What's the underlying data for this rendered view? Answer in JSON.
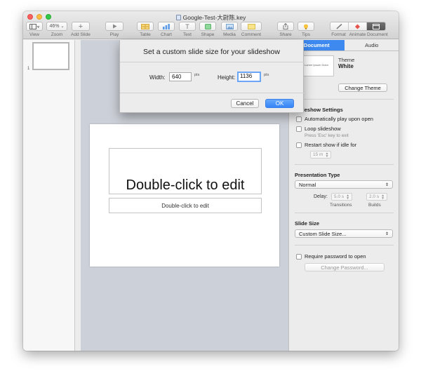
{
  "window": {
    "title": "Google-Test-大尉陈.key"
  },
  "toolbar": {
    "view_label": "View",
    "zoom_value": "46%",
    "zoom_label": "Zoom",
    "add_slide_label": "Add Slide",
    "play_label": "Play",
    "table_label": "Table",
    "chart_label": "Chart",
    "text_label": "Text",
    "shape_label": "Shape",
    "media_label": "Media",
    "comment_label": "Comment",
    "share_label": "Share",
    "tips_label": "Tips",
    "format_label": "Format",
    "animate_label": "Animate",
    "document_label": "Document"
  },
  "navigator": {
    "slide_number": "1"
  },
  "slide": {
    "title_placeholder": "Double-click to edit",
    "body_placeholder": "Double-click to edit"
  },
  "dialog": {
    "title": "Set a custom slide size for your slideshow",
    "width_label": "Width:",
    "width_value": "640",
    "width_unit": "pts",
    "height_label": "Height:",
    "height_value": "1136",
    "height_unit": "pts",
    "cancel_label": "Cancel",
    "ok_label": "OK"
  },
  "inspector": {
    "tabs": [
      {
        "label": "Document",
        "active": true
      },
      {
        "label": "Audio",
        "active": false
      }
    ],
    "theme_thumb_text": "Lorem Ipsum Dolor",
    "theme_label": "Theme",
    "theme_name": "White",
    "change_theme_label": "Change Theme",
    "slideshow_settings_title": "Slideshow Settings",
    "autoplay_label": "Automatically play upon open",
    "loop_label": "Loop slideshow",
    "loop_hint": "Press 'Esc' key to exit",
    "restart_label": "Restart show if idle for",
    "idle_value": "15 m",
    "presentation_type_title": "Presentation Type",
    "presentation_type_value": "Normal",
    "delay_label": "Delay:",
    "transitions_value": "5.0 s",
    "builds_value": "2.0 s",
    "transitions_label": "Transitions",
    "builds_label": "Builds",
    "slide_size_title": "Slide Size",
    "slide_size_value": "Custom Slide Size...",
    "password_label": "Require password to open",
    "change_password_label": "Change Password..."
  },
  "colors": {
    "accent": "#3d89f0",
    "canvas": "#ccd0d8"
  }
}
